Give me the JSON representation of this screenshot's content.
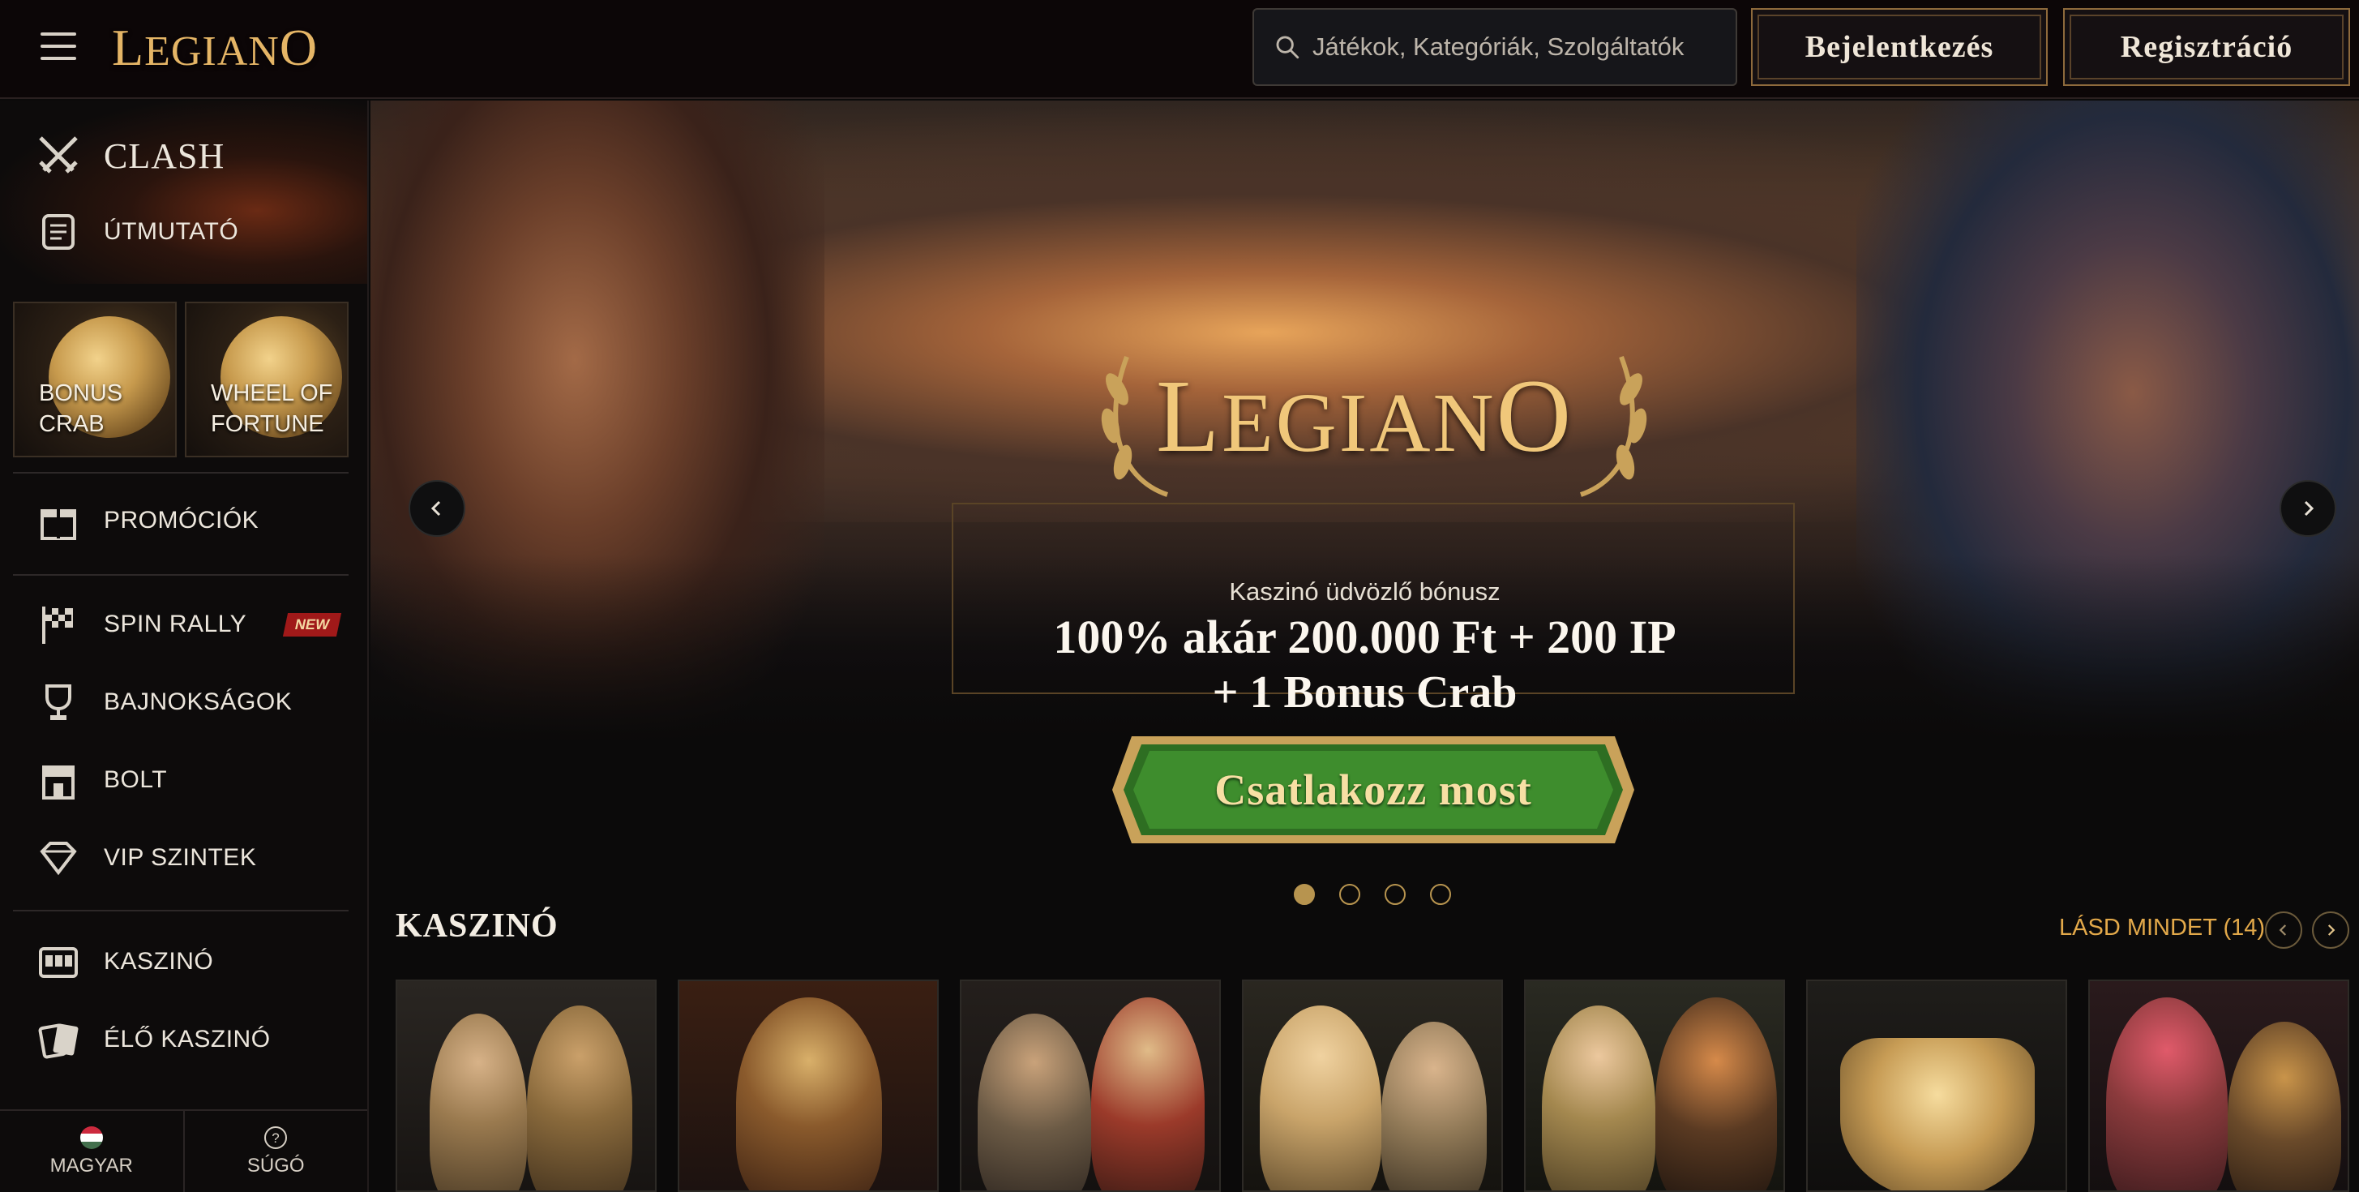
{
  "header": {
    "logo_text_big": "L",
    "logo_text_mid": "EGIAN",
    "logo_text_end": "O",
    "search_placeholder": "Játékok, Kategóriák, Szolgáltatók",
    "login_label": "Bejelentkezés",
    "register_label": "Regisztráció"
  },
  "sidebar": {
    "clash_label": "CLASH",
    "guide_label": "ÚTMUTATÓ",
    "tiles": [
      {
        "line1": "BONUS",
        "line2": "CRAB"
      },
      {
        "line1": "WHEEL OF",
        "line2": "FORTUNE"
      }
    ],
    "promotions_label": "PROMÓCIÓK",
    "items": [
      {
        "label": "SPIN RALLY",
        "badge": "NEW"
      },
      {
        "label": "BAJNOKSÁGOK"
      },
      {
        "label": "BOLT"
      },
      {
        "label": "VIP SZINTEK"
      }
    ],
    "items2": [
      {
        "label": "KASZINÓ"
      },
      {
        "label": "ÉLŐ KASZINÓ"
      }
    ],
    "bottom": {
      "language_label": "MAGYAR",
      "help_label": "SÚGÓ"
    }
  },
  "hero": {
    "logo_big": "L",
    "logo_mid": "EGIAN",
    "logo_end": "O",
    "subtitle": "Kaszinó üdvözlő bónusz",
    "offer_line1": "100% akár 200.000 Ft + 200 IP",
    "offer_line2": "+ 1 Bonus Crab",
    "cta_label": "Csatlakozz most",
    "slides_total": 4,
    "active_slide": 1
  },
  "casino": {
    "title": "KASZINÓ",
    "see_all_label": "LÁSD MINDET (14)"
  },
  "colors": {
    "gold": "#e5b566",
    "accent_orange": "#e3a94a",
    "cta_green": "#3d8a2c",
    "badge_red": "#a01919",
    "background": "#0b0a0a"
  }
}
